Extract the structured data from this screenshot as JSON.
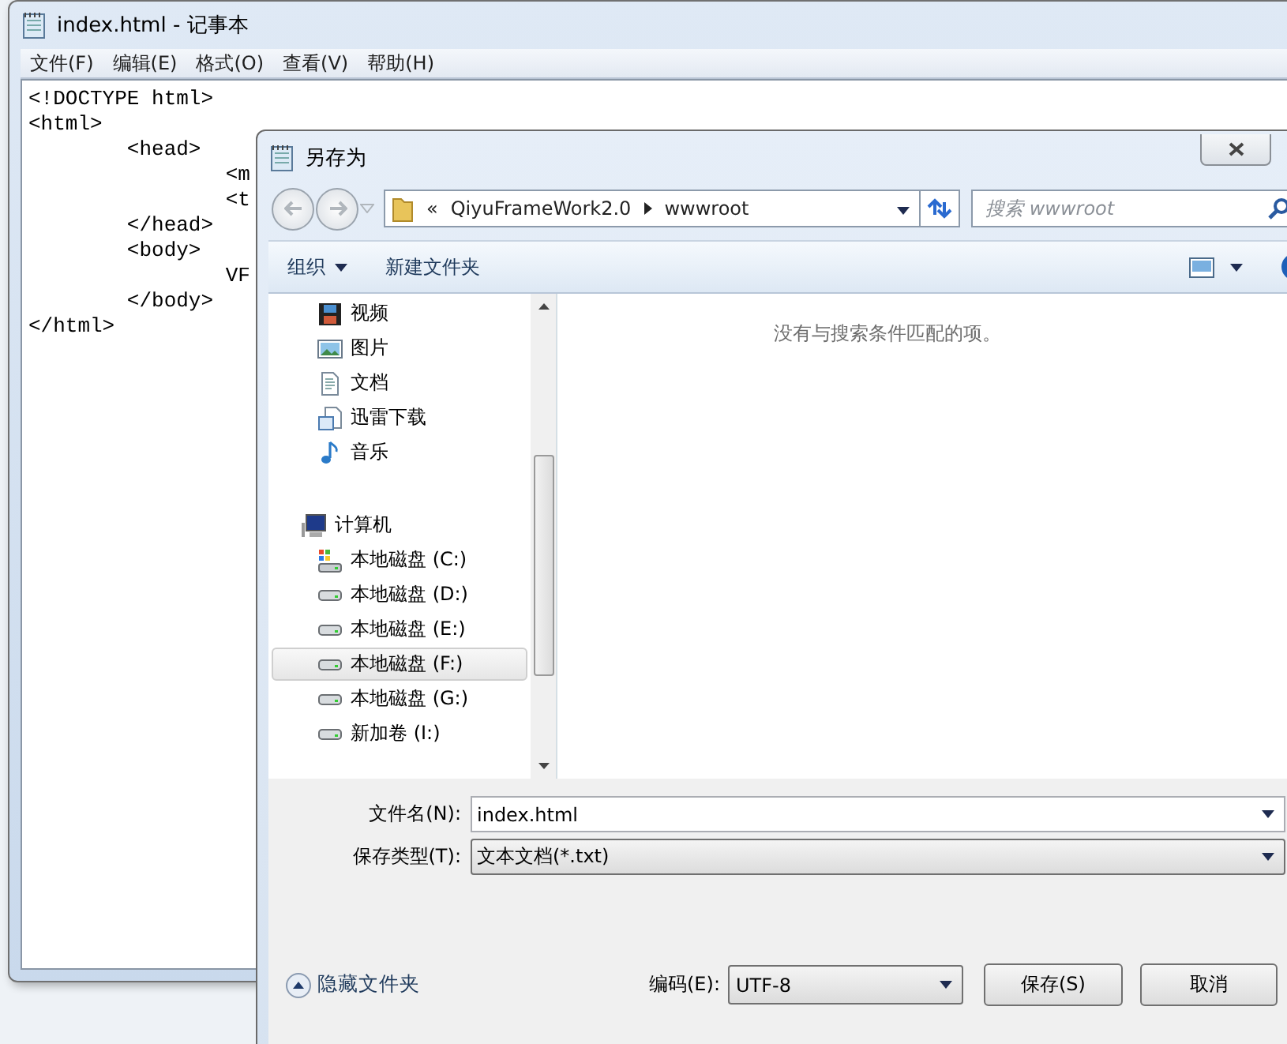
{
  "notepad": {
    "title": "index.html - 记事本",
    "menu": [
      "文件(F)",
      "编辑(E)",
      "格式(O)",
      "查看(V)",
      "帮助(H)"
    ],
    "lines": [
      "<!DOCTYPE html>",
      "<html>",
      "\t<head>",
      "\t\t<m",
      "\t\t<t",
      "\t</head>",
      "\t<body>",
      "\t\tVF",
      "\t</body>",
      "</html>"
    ]
  },
  "dialog": {
    "title": "另存为",
    "overflow": "«",
    "path": [
      "QiyuFrameWork2.0",
      "wwwroot"
    ],
    "search_placeholder": "搜索 wwwroot",
    "toolbar": {
      "organize": "组织",
      "new_folder": "新建文件夹"
    },
    "nav": {
      "libraries": [
        {
          "label": "视频",
          "kind": "video",
          "selected": false
        },
        {
          "label": "图片",
          "kind": "picture",
          "selected": false
        },
        {
          "label": "文档",
          "kind": "document",
          "selected": false
        },
        {
          "label": "迅雷下载",
          "kind": "download",
          "selected": false
        },
        {
          "label": "音乐",
          "kind": "music",
          "selected": false
        }
      ],
      "computer": {
        "label": "计算机",
        "selected": false,
        "children": [
          {
            "label": "本地磁盘 (C:)",
            "kind": "system-drive",
            "selected": false
          },
          {
            "label": "本地磁盘 (D:)",
            "kind": "drive",
            "selected": false
          },
          {
            "label": "本地磁盘 (E:)",
            "kind": "drive",
            "selected": false
          },
          {
            "label": "本地磁盘 (F:)",
            "kind": "drive",
            "selected": true
          },
          {
            "label": "本地磁盘 (G:)",
            "kind": "drive",
            "selected": false
          },
          {
            "label": "新加卷 (I:)",
            "kind": "drive",
            "selected": false
          }
        ]
      }
    },
    "empty_message": "没有与搜索条件匹配的项。",
    "file_name": {
      "label": "文件名(N):",
      "value": "index.html"
    },
    "file_type": {
      "label": "保存类型(T):",
      "value": "文本文档(*.txt)"
    },
    "hide_folders": "隐藏文件夹",
    "encoding": {
      "label": "编码(E):",
      "value": "UTF-8"
    },
    "buttons": [
      "保存(S)",
      "取消"
    ]
  }
}
